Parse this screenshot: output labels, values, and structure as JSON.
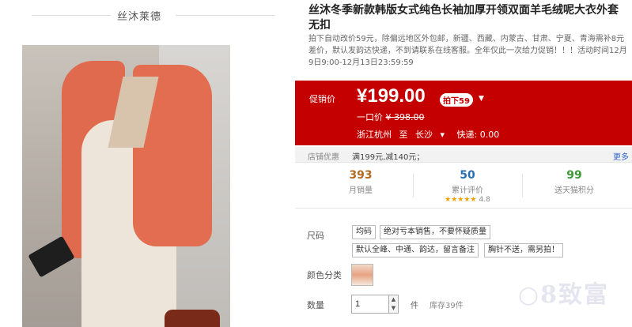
{
  "store": {
    "name": "丝沐莱德"
  },
  "product": {
    "title": "丝沐冬季新款韩版女式纯色长袖加厚开领双面羊毛绒呢大衣外套无扣",
    "promo_note": "拍下自动改价59元，除偏远地区外包邮，新疆、西藏、内蒙古、甘肃、宁夏、青海需补8元差价，默认发韵达快递，不到请联系在线客服。全年仅此一次给力促销！！！活动时间12月9日9:00-12月13日23:59:59"
  },
  "price_panel": {
    "label": "促销价",
    "price": "¥199.00",
    "badge": "拍下59",
    "badge_arrow": "▼",
    "orig_prefix": "一口价",
    "orig_price": "¥ 398.00",
    "ship_from": "浙江杭州",
    "ship_to_word": "至",
    "ship_to": "长沙",
    "ship_dropdown": "▾",
    "delivery": "快递: 0.00"
  },
  "shop_promo": {
    "label": "店铺优惠",
    "value": "满199元,减140元；",
    "more": "更多"
  },
  "stats": {
    "monthly_sales": {
      "value": "393",
      "caption": "月销量",
      "color": "#b36b1f"
    },
    "reviews": {
      "value": "50",
      "caption": "累计评价",
      "stars": "★★★★★",
      "score": "4.8",
      "color": "#2a6fb5"
    },
    "points": {
      "value": "99",
      "caption": "送天猫积分",
      "color": "#3c9a35"
    }
  },
  "options": {
    "size_label": "尺码",
    "sizes": [
      "均码",
      "绝对亏本销售，不要怀疑质量",
      "默认全峰、中通、韵达，留言备注",
      "胸针不送，需另拍！"
    ],
    "color_label": "颜色分类",
    "qty_label": "数量",
    "qty_value": "1",
    "qty_unit": "件",
    "stock": "库存39件"
  },
  "watermark": "○8致富"
}
